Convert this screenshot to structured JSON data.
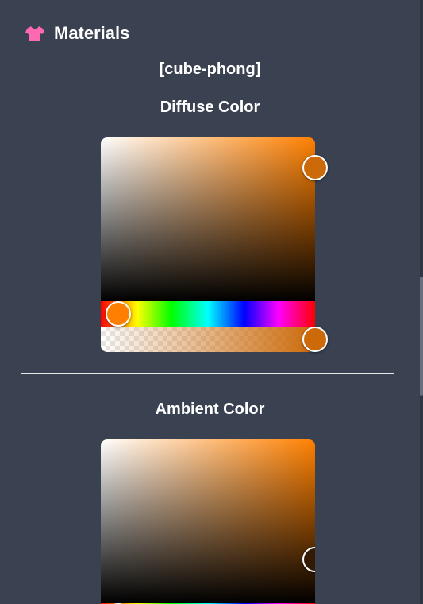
{
  "header": {
    "title": "Materials",
    "icon": "shirt-icon",
    "icon_color": "#ff69b4"
  },
  "material": {
    "name": "[cube-phong]"
  },
  "diffuse": {
    "title": "Diffuse Color",
    "hue_color": "#ff8000",
    "selected_color": "#cc6a0a",
    "saturation": 0.99,
    "value": 0.82,
    "hue": 0.08,
    "alpha": 1.0
  },
  "ambient": {
    "title": "Ambient Color",
    "hue_color": "#ff8000",
    "selected_color": "#331a04",
    "saturation": 0.99,
    "value": 0.26,
    "hue": 0.08
  }
}
